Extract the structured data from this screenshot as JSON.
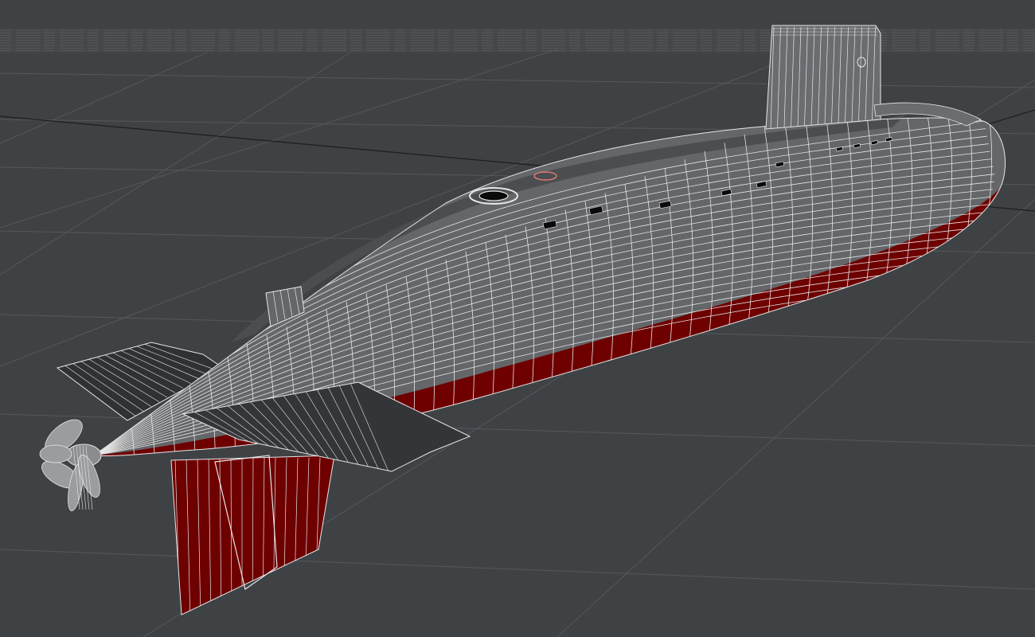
{
  "viewport": {
    "background_color": "#3f4245",
    "ground_color": "#414447",
    "horizon_color": "#45484b",
    "grid_color": "#55585b",
    "axis_color": "#1c1e20"
  },
  "model": {
    "hull_fill": "#646669",
    "deck_fill": "#4b4d50",
    "lower_hull_fill": "#6e0000",
    "wire_color": "#e6e6e6",
    "hatch_color": "#0a0a0a"
  },
  "icons": [
    "propeller-icon"
  ]
}
